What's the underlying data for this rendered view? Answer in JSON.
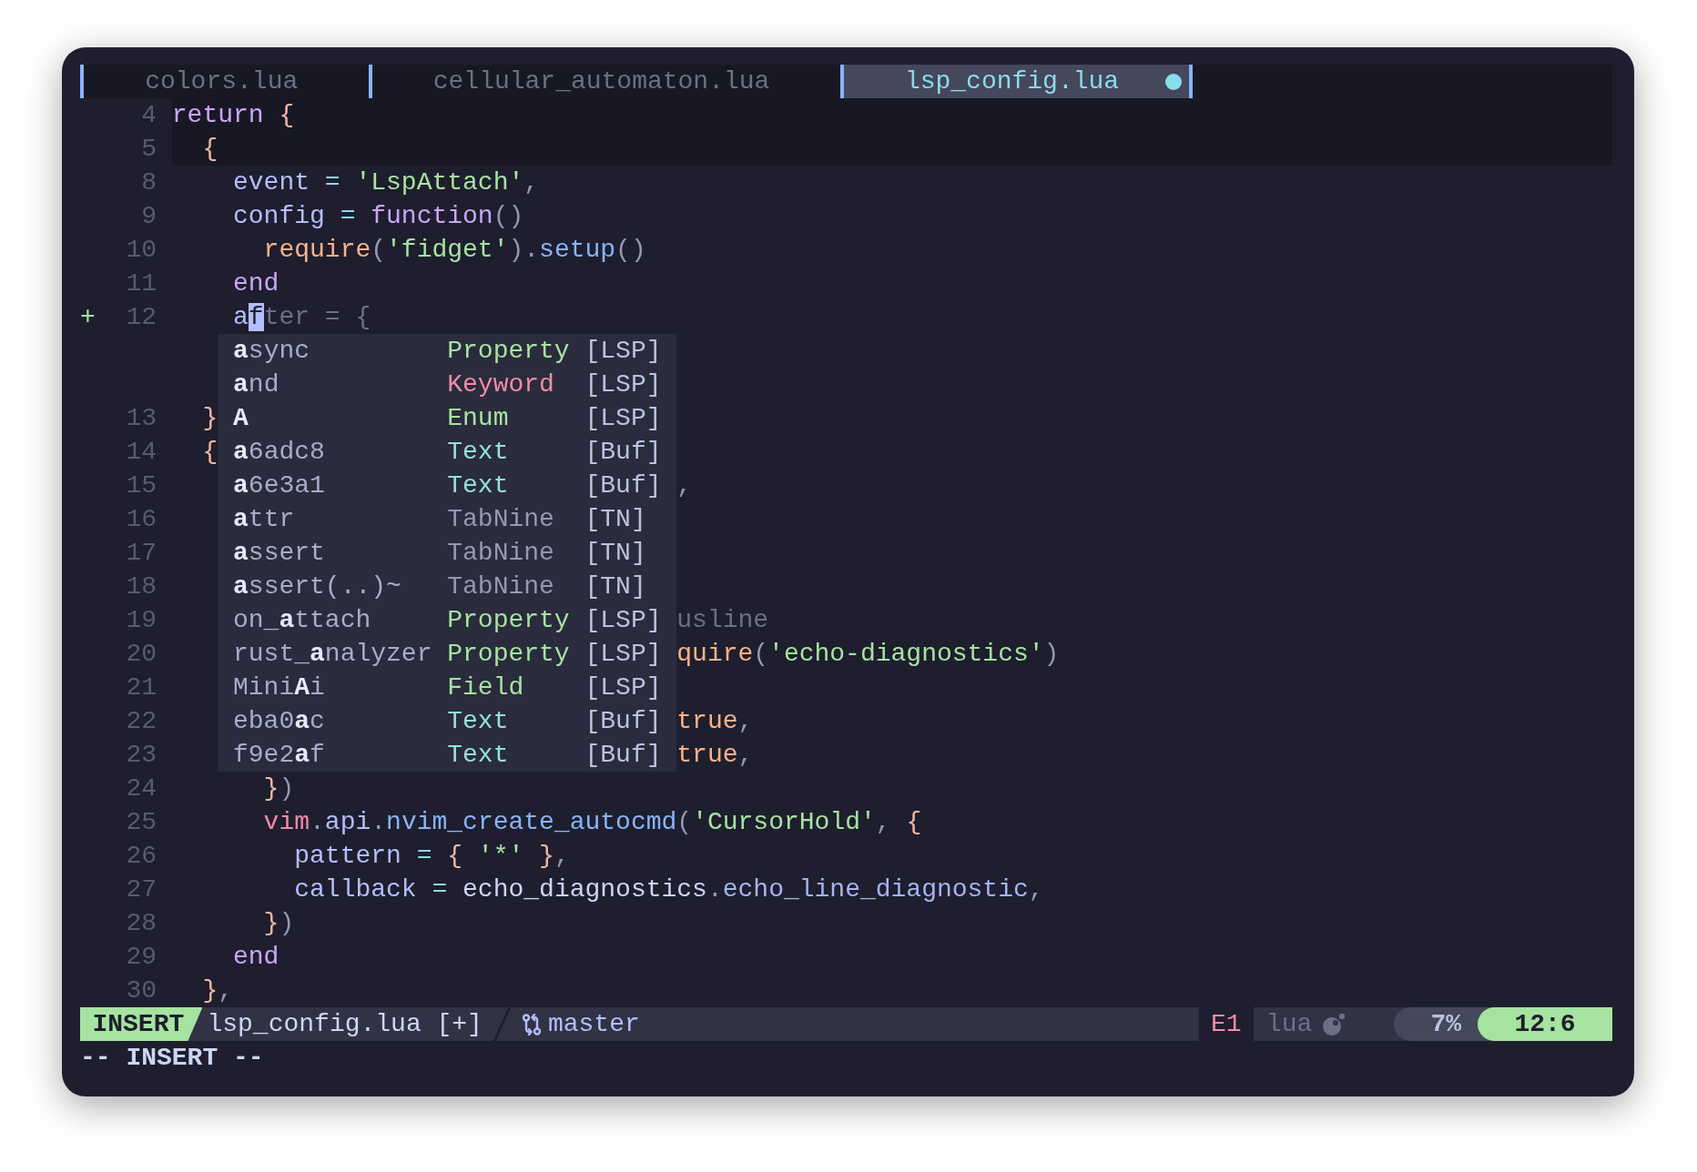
{
  "tabs": [
    {
      "label": "colors.lua",
      "selected": false,
      "modified": false
    },
    {
      "label": "cellular_automaton.lua",
      "selected": false,
      "modified": false
    },
    {
      "label": "lsp_config.lua",
      "selected": true,
      "modified": true
    }
  ],
  "editor": {
    "context_lines": [
      {
        "kind": "code",
        "number": "4",
        "tokens": [
          {
            "text": "return ",
            "kind": "keyword"
          },
          {
            "text": "{",
            "kind": "brace"
          }
        ]
      },
      {
        "kind": "code",
        "number": "5",
        "tokens": [
          {
            "text": "  {",
            "kind": "brace"
          }
        ]
      }
    ],
    "lines": [
      {
        "kind": "code",
        "number": "8",
        "tokens": [
          {
            "text": "    event ",
            "kind": "field"
          },
          {
            "text": "= ",
            "kind": "op"
          },
          {
            "text": "'LspAttach'",
            "kind": "string"
          },
          {
            "text": ",",
            "kind": "punct"
          }
        ]
      },
      {
        "kind": "code",
        "number": "9",
        "tokens": [
          {
            "text": "    config ",
            "kind": "field"
          },
          {
            "text": "= ",
            "kind": "op"
          },
          {
            "text": "function",
            "kind": "keyword"
          },
          {
            "text": "()",
            "kind": "punct"
          }
        ]
      },
      {
        "kind": "code",
        "number": "10",
        "tokens": [
          {
            "text": "      require",
            "kind": "call"
          },
          {
            "text": "(",
            "kind": "punct"
          },
          {
            "text": "'fidget'",
            "kind": "string"
          },
          {
            "text": ")",
            "kind": "punct"
          },
          {
            "text": ".",
            "kind": "punct"
          },
          {
            "text": "setup",
            "kind": "func"
          },
          {
            "text": "()",
            "kind": "punct"
          }
        ]
      },
      {
        "kind": "code",
        "number": "11",
        "tokens": [
          {
            "text": "    end",
            "kind": "keyword"
          }
        ]
      },
      {
        "kind": "code",
        "number": "12",
        "sign": "+",
        "tokens": [
          {
            "text": "    a",
            "kind": "field"
          },
          {
            "text": "f",
            "kind": "cursor"
          },
          {
            "text": "ter = {",
            "kind": "ghost"
          }
        ]
      },
      {
        "kind": "virtual"
      },
      {
        "kind": "virtual"
      },
      {
        "kind": "code",
        "number": "13",
        "tokens": [
          {
            "text": "  }",
            "kind": "brace"
          }
        ]
      },
      {
        "kind": "code",
        "number": "14",
        "tokens": [
          {
            "text": "  {",
            "kind": "brace"
          }
        ]
      },
      {
        "kind": "code",
        "number": "15",
        "trailing": [
          {
            "text": ",",
            "kind": "punct"
          }
        ]
      },
      {
        "kind": "code",
        "number": "16"
      },
      {
        "kind": "code",
        "number": "17"
      },
      {
        "kind": "code",
        "number": "18"
      },
      {
        "kind": "code",
        "number": "19",
        "trailing": [
          {
            "text": "usline",
            "kind": "ghost"
          }
        ]
      },
      {
        "kind": "code",
        "number": "20",
        "trailing": [
          {
            "text": "quire",
            "kind": "call"
          },
          {
            "text": "(",
            "kind": "punct"
          },
          {
            "text": "'echo-diagnostics'",
            "kind": "string"
          },
          {
            "text": ")",
            "kind": "punct"
          }
        ]
      },
      {
        "kind": "code",
        "number": "21"
      },
      {
        "kind": "code",
        "number": "22",
        "trailing": [
          {
            "text": "true",
            "kind": "constant"
          },
          {
            "text": ",",
            "kind": "punct"
          }
        ]
      },
      {
        "kind": "code",
        "number": "23",
        "trailing": [
          {
            "text": "true",
            "kind": "constant"
          },
          {
            "text": ",",
            "kind": "punct"
          }
        ]
      },
      {
        "kind": "code",
        "number": "24",
        "tokens": [
          {
            "text": "      }",
            "kind": "brace"
          },
          {
            "text": ")",
            "kind": "punct"
          }
        ]
      },
      {
        "kind": "code",
        "number": "25",
        "tokens": [
          {
            "text": "      vim",
            "kind": "builtin"
          },
          {
            "text": ".",
            "kind": "punct"
          },
          {
            "text": "api",
            "kind": "field"
          },
          {
            "text": ".",
            "kind": "punct"
          },
          {
            "text": "nvim_create_autocmd",
            "kind": "func"
          },
          {
            "text": "(",
            "kind": "punct"
          },
          {
            "text": "'CursorHold'",
            "kind": "string"
          },
          {
            "text": ", ",
            "kind": "punct"
          },
          {
            "text": "{",
            "kind": "brace"
          }
        ]
      },
      {
        "kind": "code",
        "number": "26",
        "tokens": [
          {
            "text": "        pattern ",
            "kind": "field"
          },
          {
            "text": "= ",
            "kind": "op"
          },
          {
            "text": "{ ",
            "kind": "brace"
          },
          {
            "text": "'*' ",
            "kind": "string"
          },
          {
            "text": "}",
            "kind": "brace"
          },
          {
            "text": ",",
            "kind": "punct"
          }
        ]
      },
      {
        "kind": "code",
        "number": "27",
        "tokens": [
          {
            "text": "        callback ",
            "kind": "field"
          },
          {
            "text": "= ",
            "kind": "op"
          },
          {
            "text": "echo_diagnostics",
            "kind": "plain"
          },
          {
            "text": ".",
            "kind": "punct"
          },
          {
            "text": "echo_line_diagnostic",
            "kind": "method"
          },
          {
            "text": ",",
            "kind": "punct"
          }
        ]
      },
      {
        "kind": "code",
        "number": "28",
        "tokens": [
          {
            "text": "      }",
            "kind": "brace"
          },
          {
            "text": ")",
            "kind": "punct"
          }
        ]
      },
      {
        "kind": "code",
        "number": "29",
        "tokens": [
          {
            "text": "    end",
            "kind": "keyword"
          }
        ]
      },
      {
        "kind": "code",
        "number": "30",
        "tokens": [
          {
            "text": "  }",
            "kind": "brace"
          },
          {
            "text": ",",
            "kind": "punct"
          }
        ]
      }
    ],
    "completion": [
      {
        "label": "**a**sync",
        "type": "Property",
        "color": "#a6e3a1",
        "source": "[LSP]"
      },
      {
        "label": "**a**nd",
        "type": "Keyword",
        "color": "#f38ba8",
        "source": "[LSP]"
      },
      {
        "label": "**A**",
        "type": "Enum",
        "color": "#a6e3a1",
        "source": "[LSP]"
      },
      {
        "label": "**a**6adc8",
        "type": "Text",
        "color": "#94e2d5",
        "source": "[Buf]"
      },
      {
        "label": "**a**6e3a1",
        "type": "Text",
        "color": "#94e2d5",
        "source": "[Buf]"
      },
      {
        "label": "**a**ttr",
        "type": "TabNine",
        "color": "#9399b2",
        "source": "[TN]"
      },
      {
        "label": "**a**ssert",
        "type": "TabNine",
        "color": "#9399b2",
        "source": "[TN]"
      },
      {
        "label": "**a**ssert(..)~",
        "type": "TabNine",
        "color": "#9399b2",
        "source": "[TN]"
      },
      {
        "label": "on_**a**ttach",
        "type": "Property",
        "color": "#a6e3a1",
        "source": "[LSP]"
      },
      {
        "label": "rust_**a**nalyzer",
        "type": "Property",
        "color": "#a6e3a1",
        "source": "[LSP]"
      },
      {
        "label": "Mini**A**i",
        "type": "Field",
        "color": "#a6e3a1",
        "source": "[LSP]"
      },
      {
        "label": "eba0**a**c",
        "type": "Text",
        "color": "#94e2d5",
        "source": "[Buf]"
      },
      {
        "label": "f9e2**a**f",
        "type": "Text",
        "color": "#94e2d5",
        "source": "[Buf]"
      }
    ]
  },
  "status_bar": {
    "mode": "INSERT",
    "file": "lsp_config.lua [+]",
    "branch": "master",
    "diagnostics": "E1",
    "filetype": "lua",
    "percent": "7%",
    "position": "12:6"
  },
  "command_line": "-- INSERT --"
}
